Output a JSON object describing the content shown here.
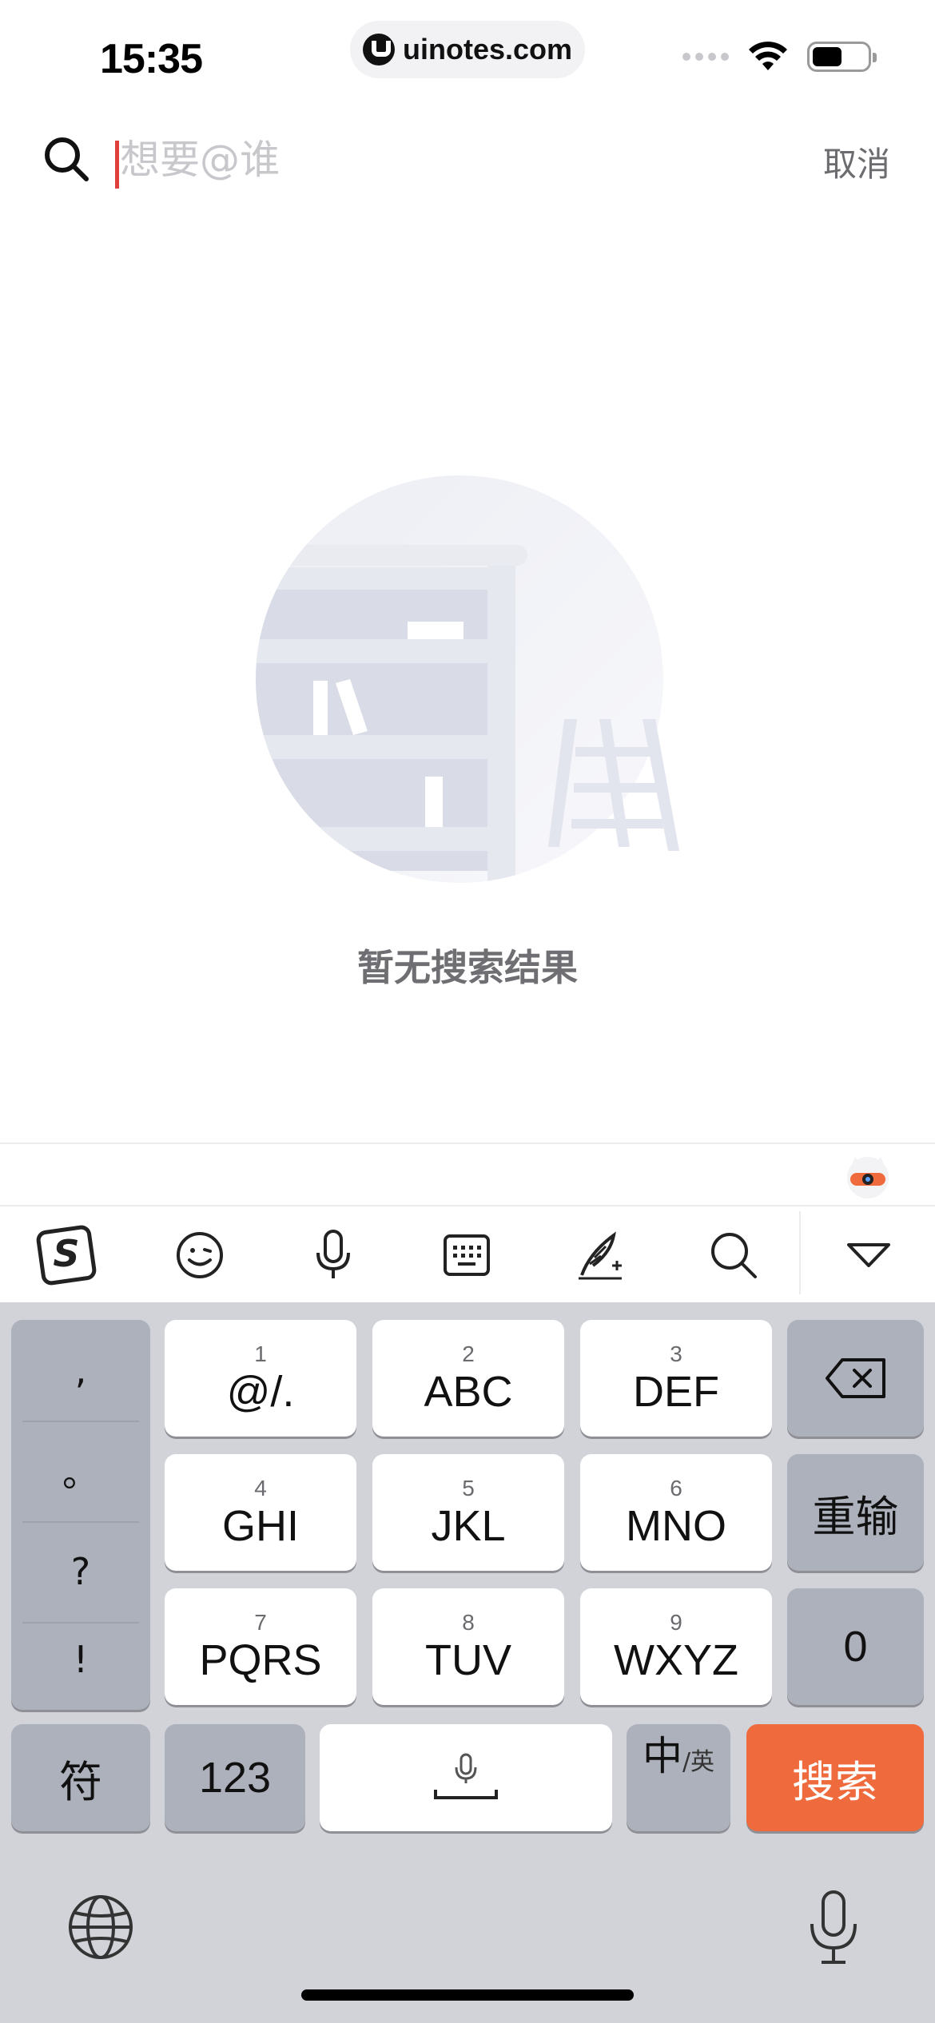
{
  "status_bar": {
    "time": "15:35",
    "url": "uinotes.com"
  },
  "search": {
    "placeholder": "想要@谁",
    "value": "",
    "cancel_label": "取消"
  },
  "empty_state": {
    "message": "暂无搜索结果"
  },
  "keyboard": {
    "punctuation": [
      ",",
      "。",
      "?",
      "!"
    ],
    "keys": [
      {
        "num": "1",
        "letters": "@/."
      },
      {
        "num": "2",
        "letters": "ABC"
      },
      {
        "num": "3",
        "letters": "DEF"
      },
      {
        "num": "4",
        "letters": "GHI"
      },
      {
        "num": "5",
        "letters": "JKL"
      },
      {
        "num": "6",
        "letters": "MNO"
      },
      {
        "num": "7",
        "letters": "PQRS"
      },
      {
        "num": "8",
        "letters": "TUV"
      },
      {
        "num": "9",
        "letters": "WXYZ"
      }
    ],
    "reenter_label": "重输",
    "zero_label": "0",
    "symbol_label": "符",
    "numeric_label": "123",
    "lang_label_main": "中",
    "lang_label_sub": "/英",
    "search_label": "搜索",
    "search_key_color": "#ef6a3c"
  }
}
